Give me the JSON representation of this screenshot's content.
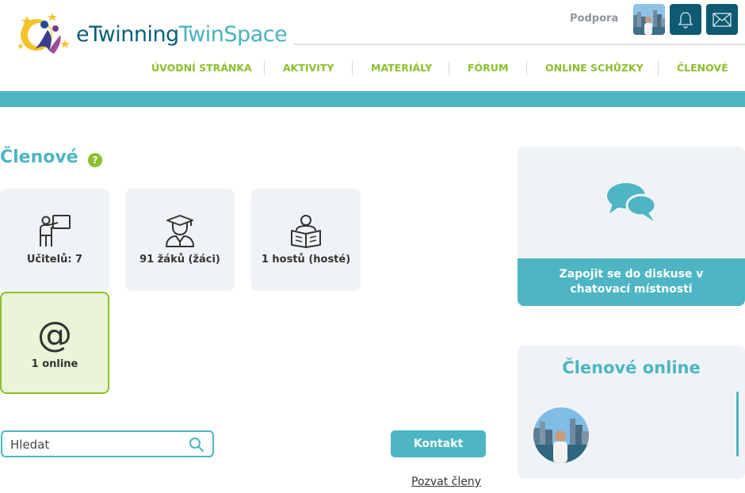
{
  "header": {
    "logo_text_1": "eTwinning",
    "logo_text_2": "TwinSpace",
    "support_label": "Podpora",
    "icons": [
      "user-avatar",
      "bell-icon",
      "mail-icon"
    ]
  },
  "nav": {
    "items": [
      {
        "label": "ÚVODNÍ STRÁNKA"
      },
      {
        "label": "AKTIVITY"
      },
      {
        "label": "MATERIÁLY"
      },
      {
        "label": "FÓRUM"
      },
      {
        "label": "ONLINE SCHŮZKY"
      },
      {
        "label": "ČLENOVÉ"
      }
    ]
  },
  "colors": {
    "teal": "#4db5c3",
    "green": "#8cbf2c",
    "dark_blue": "#0f5a73",
    "card_bg": "#f0f3f6"
  },
  "main": {
    "title": "Členové",
    "help_icon": "?",
    "cards": [
      {
        "icon": "teacher-icon",
        "label": "Učitelů: 7"
      },
      {
        "icon": "student-icon",
        "label": "91 žáků (žáci)"
      },
      {
        "icon": "guest-reader-icon",
        "label": "1 hostů (hosté)"
      },
      {
        "icon": "at-icon",
        "glyph": "@",
        "label": "1 online"
      }
    ],
    "search": {
      "placeholder": "Hledat"
    },
    "contact_label": "Kontakt",
    "invite_label": "Pozvat členy"
  },
  "sidebar": {
    "chat_label": "Zapojit se do diskuse v chatovací místnosti",
    "online_title": "Členové online"
  }
}
